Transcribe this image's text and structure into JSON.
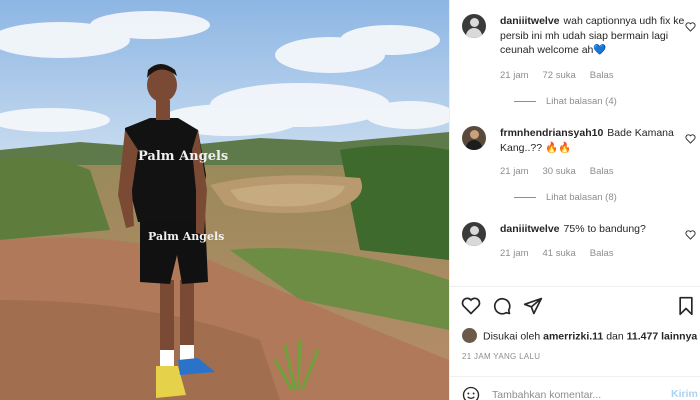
{
  "post": {
    "photo_description_icon": "post-photo",
    "print": {
      "shirt": "Palm Angels",
      "shorts": "Palm Angels"
    }
  },
  "comments": [
    {
      "username": "daniiitwelve",
      "text": "wah captionnya udh fix ke persib ini mh udah siap bermain lagi ceunah welcome ah💙",
      "time": "21 jam",
      "likes": "72 suka",
      "reply_label": "Balas",
      "view_replies": "Lihat balasan (4)"
    },
    {
      "username": "frmnhendriansyah10",
      "text": "Bade Kamana Kang..?? 🔥🔥",
      "time": "21 jam",
      "likes": "30 suka",
      "reply_label": "Balas",
      "view_replies": "Lihat balasan (8)"
    },
    {
      "username": "daniiitwelve",
      "text": "75% to bandung?",
      "time": "21 jam",
      "likes": "41 suka",
      "reply_label": "Balas"
    }
  ],
  "likes_line": {
    "prefix": "Disukai oleh",
    "user": "amerrizki.11",
    "middle": "dan",
    "count": "11.477 lainnya"
  },
  "time_ago": "21 JAM YANG LALU",
  "comment_box": {
    "placeholder": "Tambahkan komentar...",
    "send_label": "Kirim"
  },
  "colors": {
    "text": "#262626",
    "muted": "#8e8e8e",
    "send_disabled": "#a8d3f5",
    "divider": "#efefef"
  }
}
